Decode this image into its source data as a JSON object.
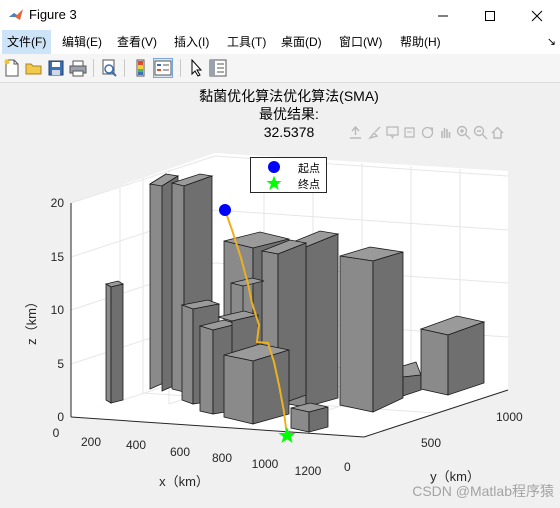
{
  "window": {
    "title": "Figure 3",
    "minimize": "—",
    "maximize": "☐",
    "close": "✕"
  },
  "menu": {
    "items": [
      "文件(F)",
      "编辑(E)",
      "查看(V)",
      "插入(I)",
      "工具(T)",
      "桌面(D)",
      "窗口(W)",
      "帮助(H)"
    ],
    "overflow_icon": "menu-dock-arrow"
  },
  "toolbar": {
    "icons": [
      "new-figure-icon",
      "open-file-icon",
      "save-icon",
      "print-icon",
      "print-preview-icon",
      "colorbar-icon",
      "legend-icon",
      "pointer-icon",
      "property-inspector-icon"
    ]
  },
  "axes_toolbar": {
    "icons": [
      "export-icon",
      "brush-icon",
      "datatip-icon",
      "rotate-icon",
      "pan-icon",
      "zoom-in-icon",
      "zoom-out-icon",
      "home-icon"
    ]
  },
  "chart_data": {
    "type": "3d-path",
    "title": [
      "黏菌优化算法优化算法(SMA)",
      "最优结果:",
      "32.5378"
    ],
    "xlabel": "x（km）",
    "ylabel": "y（km）",
    "zlabel": "z（km）",
    "xlim": [
      0,
      1200
    ],
    "ylim": [
      0,
      1000
    ],
    "zlim": [
      0,
      20
    ],
    "x_ticks": [
      "0",
      "200",
      "400",
      "600",
      "800",
      "1000",
      "1200"
    ],
    "y_ticks": [
      "0",
      "500",
      "1000"
    ],
    "z_ticks": [
      "0",
      "5",
      "10",
      "15",
      "20"
    ],
    "grid": true,
    "legend": {
      "location": "top",
      "entries": [
        {
          "label": "起点",
          "marker": "circle",
          "color": "#0000ff"
        },
        {
          "label": "终点",
          "marker": "star",
          "color": "#00ff00"
        }
      ]
    },
    "path_color": "#edb120",
    "obstacle_color": "#808080"
  },
  "watermark": "CSDN @Matlab程序猿"
}
